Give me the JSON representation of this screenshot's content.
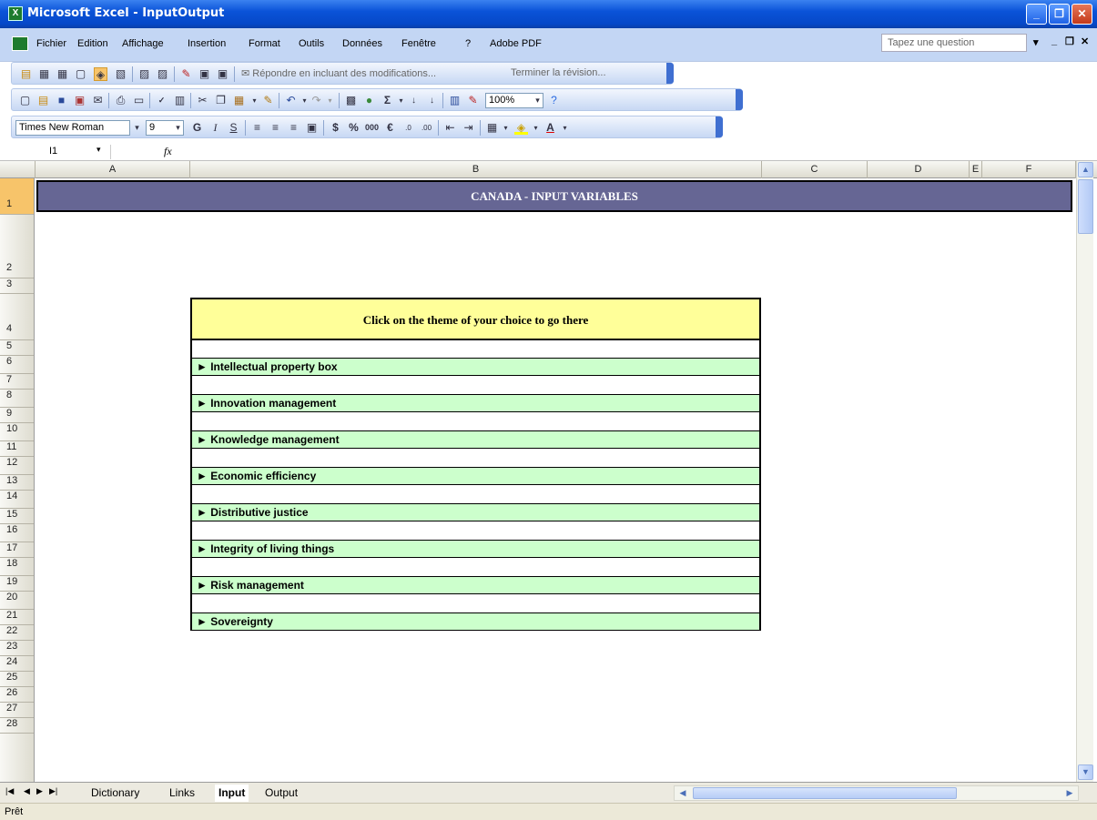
{
  "window": {
    "title": "Microsoft Excel - InputOutput"
  },
  "menubar": {
    "items": [
      "Fichier",
      "Edition",
      "Affichage",
      "Insertion",
      "Format",
      "Outils",
      "Données",
      "Fenêtre",
      "?",
      "Adobe PDF"
    ],
    "ask_placeholder": "Tapez une question"
  },
  "review_toolbar": {
    "reply_text": "Répondre en incluant des modifications...",
    "end_review_text": "Terminer la révision..."
  },
  "std_toolbar": {
    "zoom": "100%"
  },
  "format_toolbar": {
    "font": "Times New Roman",
    "size": "9"
  },
  "formula_bar": {
    "cell_ref": "I1",
    "fx": "fx",
    "content": ""
  },
  "columns": [
    "A",
    "B",
    "C",
    "D",
    "E",
    "F"
  ],
  "rows": [
    "1",
    "2",
    "3",
    "4",
    "5",
    "6",
    "7",
    "8",
    "9",
    "10",
    "11",
    "12",
    "13",
    "14",
    "15",
    "16",
    "17",
    "18",
    "19",
    "20",
    "21",
    "22",
    "23",
    "24",
    "25",
    "26",
    "27",
    "28"
  ],
  "sheet": {
    "banner": "CANADA - INPUT VARIABLES",
    "menu_title": "Click on the theme of your choice to go there",
    "themes": [
      "► Intellectual property box",
      "► Innovation management",
      "► Knowledge management",
      "► Economic efficiency",
      "► Distributive justice",
      "► Integrity of living things",
      "► Risk management",
      "► Sovereignty"
    ],
    "colors": {
      "banner_bg": "#666694",
      "menu_head_bg": "#ffff99",
      "link_bg": "#ccffcc"
    }
  },
  "tabs": [
    "Dictionary",
    "Links",
    "Input",
    "Output"
  ],
  "active_tab": "Input",
  "status": "Prêt"
}
